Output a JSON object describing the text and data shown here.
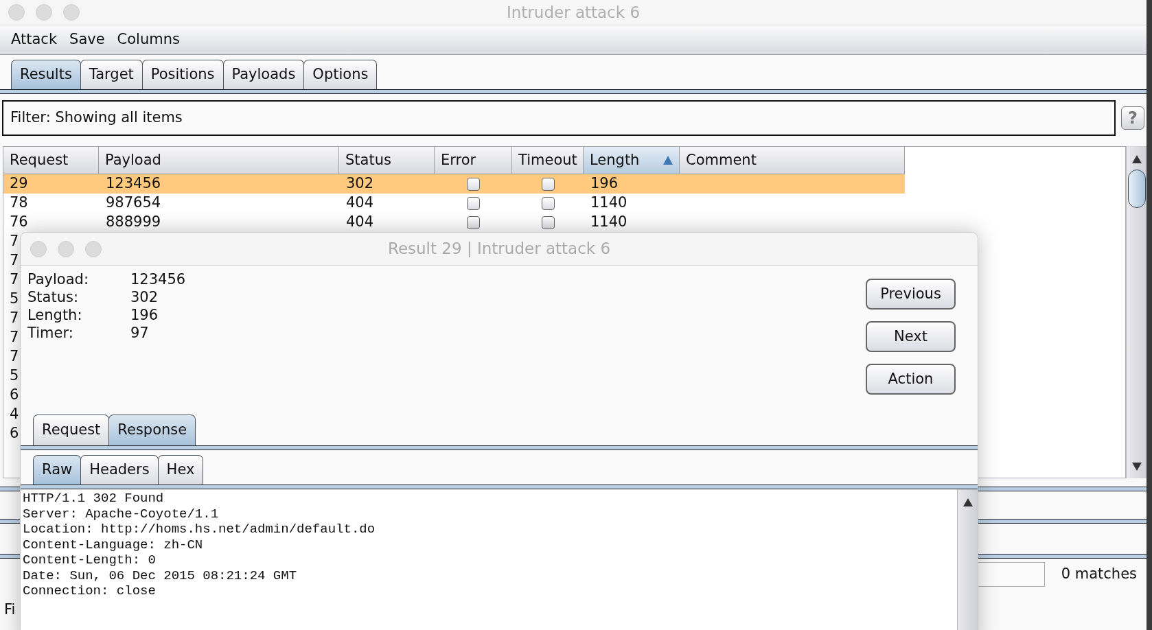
{
  "window": {
    "title": "Intruder attack 6"
  },
  "menu": [
    "Attack",
    "Save",
    "Columns"
  ],
  "tabs": [
    {
      "label": "Results",
      "selected": true
    },
    {
      "label": "Target",
      "selected": false
    },
    {
      "label": "Positions",
      "selected": false
    },
    {
      "label": "Payloads",
      "selected": false
    },
    {
      "label": "Options",
      "selected": false
    }
  ],
  "filter": {
    "text": "Filter: Showing all items",
    "help": "?"
  },
  "table": {
    "columns": [
      {
        "label": "Request",
        "sorted": false
      },
      {
        "label": "Payload",
        "sorted": false
      },
      {
        "label": "Status",
        "sorted": false
      },
      {
        "label": "Error",
        "sorted": false
      },
      {
        "label": "Timeout",
        "sorted": false
      },
      {
        "label": "Length",
        "sorted": true
      },
      {
        "label": "Comment",
        "sorted": false
      }
    ],
    "rows": [
      {
        "request": "29",
        "payload": "123456",
        "status": "302",
        "error": false,
        "timeout": false,
        "length": "196",
        "selected": true
      },
      {
        "request": "78",
        "payload": "987654",
        "status": "404",
        "error": false,
        "timeout": false,
        "length": "1140",
        "selected": false
      },
      {
        "request": "76",
        "payload": "888999",
        "status": "404",
        "error": false,
        "timeout": false,
        "length": "1140",
        "selected": false
      },
      {
        "request": "7",
        "selected": false
      },
      {
        "request": "7",
        "selected": false
      },
      {
        "request": "7",
        "selected": false
      },
      {
        "request": "5",
        "selected": false
      },
      {
        "request": "7",
        "selected": false
      },
      {
        "request": "7",
        "selected": false
      },
      {
        "request": "7",
        "selected": false
      },
      {
        "request": "5",
        "selected": false
      },
      {
        "request": "6",
        "selected": false
      },
      {
        "request": "4",
        "selected": false
      },
      {
        "request": "6",
        "selected": false
      }
    ]
  },
  "search": {
    "matches": "0 matches"
  },
  "status_bar": {
    "text": "Fi"
  },
  "dialog": {
    "title": "Result 29 | Intruder attack 6",
    "fields": [
      {
        "label": "Payload:",
        "value": "123456"
      },
      {
        "label": "Status:",
        "value": "302"
      },
      {
        "label": "Length:",
        "value": "196"
      },
      {
        "label": "Timer:",
        "value": "97"
      }
    ],
    "buttons": [
      "Previous",
      "Next",
      "Action"
    ],
    "tabs": [
      {
        "label": "Request",
        "selected": false
      },
      {
        "label": "Response",
        "selected": true
      }
    ],
    "view_tabs": [
      {
        "label": "Raw",
        "selected": true
      },
      {
        "label": "Headers",
        "selected": false
      },
      {
        "label": "Hex",
        "selected": false
      }
    ],
    "response": [
      "HTTP/1.1 302 Found",
      "Server: Apache-Coyote/1.1",
      "Location: http://homs.hs.net/admin/default.do",
      "Content-Language: zh-CN",
      "Content-Length: 0",
      "Date: Sun, 06 Dec 2015 08:21:24 GMT",
      "Connection: close"
    ]
  }
}
